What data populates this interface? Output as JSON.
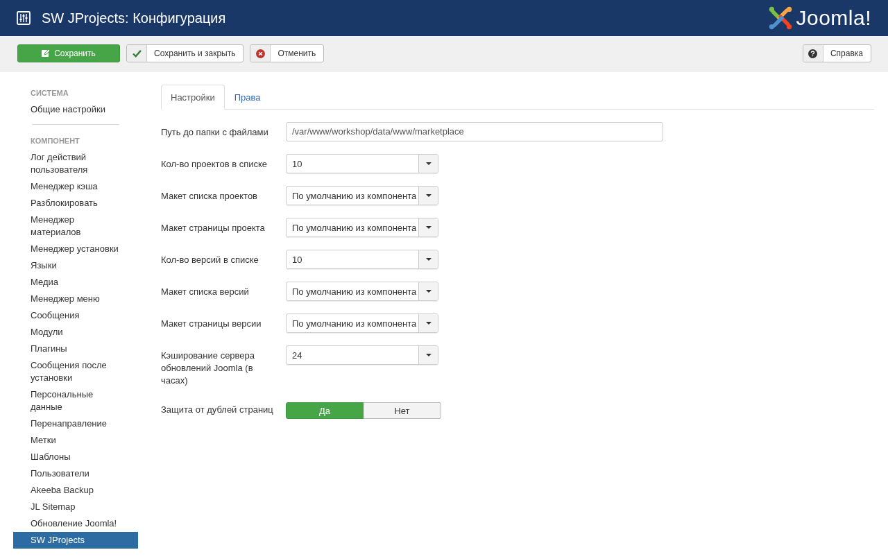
{
  "header": {
    "title": "SW JProjects: Конфигурация",
    "brand": "Joomla!"
  },
  "toolbar": {
    "buttons": [
      {
        "label": "Сохранить",
        "kind": "primary"
      },
      {
        "label": "Сохранить и закрыть",
        "kind": "default"
      },
      {
        "label": "Отменить",
        "kind": "default"
      }
    ],
    "help_button": {
      "label": "Справка"
    }
  },
  "sidebar": {
    "sections": [
      {
        "heading": "СИСТЕМА",
        "items": [
          {
            "label": "Общие настройки",
            "selected": false
          }
        ]
      },
      {
        "heading": "КОМПОНЕНТ",
        "items": [
          {
            "label": "Лог действий пользователя",
            "selected": false
          },
          {
            "label": "Менеджер кэша",
            "selected": false
          },
          {
            "label": "Разблокировать",
            "selected": false
          },
          {
            "label": "Менеджер материалов",
            "selected": false
          },
          {
            "label": "Менеджер установки",
            "selected": false
          },
          {
            "label": "Языки",
            "selected": false
          },
          {
            "label": "Медиа",
            "selected": false
          },
          {
            "label": "Менеджер меню",
            "selected": false
          },
          {
            "label": "Сообщения",
            "selected": false
          },
          {
            "label": "Модули",
            "selected": false
          },
          {
            "label": "Плагины",
            "selected": false
          },
          {
            "label": "Сообщения после установки",
            "selected": false
          },
          {
            "label": "Персональные данные",
            "selected": false
          },
          {
            "label": "Перенаправление",
            "selected": false
          },
          {
            "label": "Метки",
            "selected": false
          },
          {
            "label": "Шаблоны",
            "selected": false
          },
          {
            "label": "Пользователи",
            "selected": false
          },
          {
            "label": "Akeeba Backup",
            "selected": false
          },
          {
            "label": "JL Sitemap",
            "selected": false
          },
          {
            "label": "Обновление Joomla!",
            "selected": false
          },
          {
            "label": "SW JProjects",
            "selected": true
          }
        ]
      }
    ]
  },
  "tabs": [
    {
      "label": "Настройки",
      "selected": true
    },
    {
      "label": "Права",
      "selected": false
    }
  ],
  "fields": [
    {
      "label": "Путь до папки с файлами",
      "kind": "text",
      "value": "/var/www/workshop/data/www/marketplace"
    },
    {
      "label": "Кол-во проектов в списке",
      "kind": "select",
      "value": "10"
    },
    {
      "label": "Макет списка проектов",
      "kind": "select",
      "value": "По умолчанию из компонента"
    },
    {
      "label": "Макет страницы проекта",
      "kind": "select",
      "value": "По умолчанию из компонента"
    },
    {
      "label": "Кол-во версий в списке",
      "kind": "select",
      "value": "10"
    },
    {
      "label": "Макет списка версий",
      "kind": "select",
      "value": "По умолчанию из компонента"
    },
    {
      "label": "Макет страницы версии",
      "kind": "select",
      "value": "По умолчанию из компонента"
    },
    {
      "label": "Кэширование сервера обновлений Joomla (в часах)",
      "kind": "select",
      "value": "24"
    },
    {
      "label": "Защита от дублей страниц",
      "kind": "toggle",
      "options": [
        {
          "label": "Да",
          "selected": true
        },
        {
          "label": "Нет",
          "selected": false
        }
      ]
    }
  ]
}
